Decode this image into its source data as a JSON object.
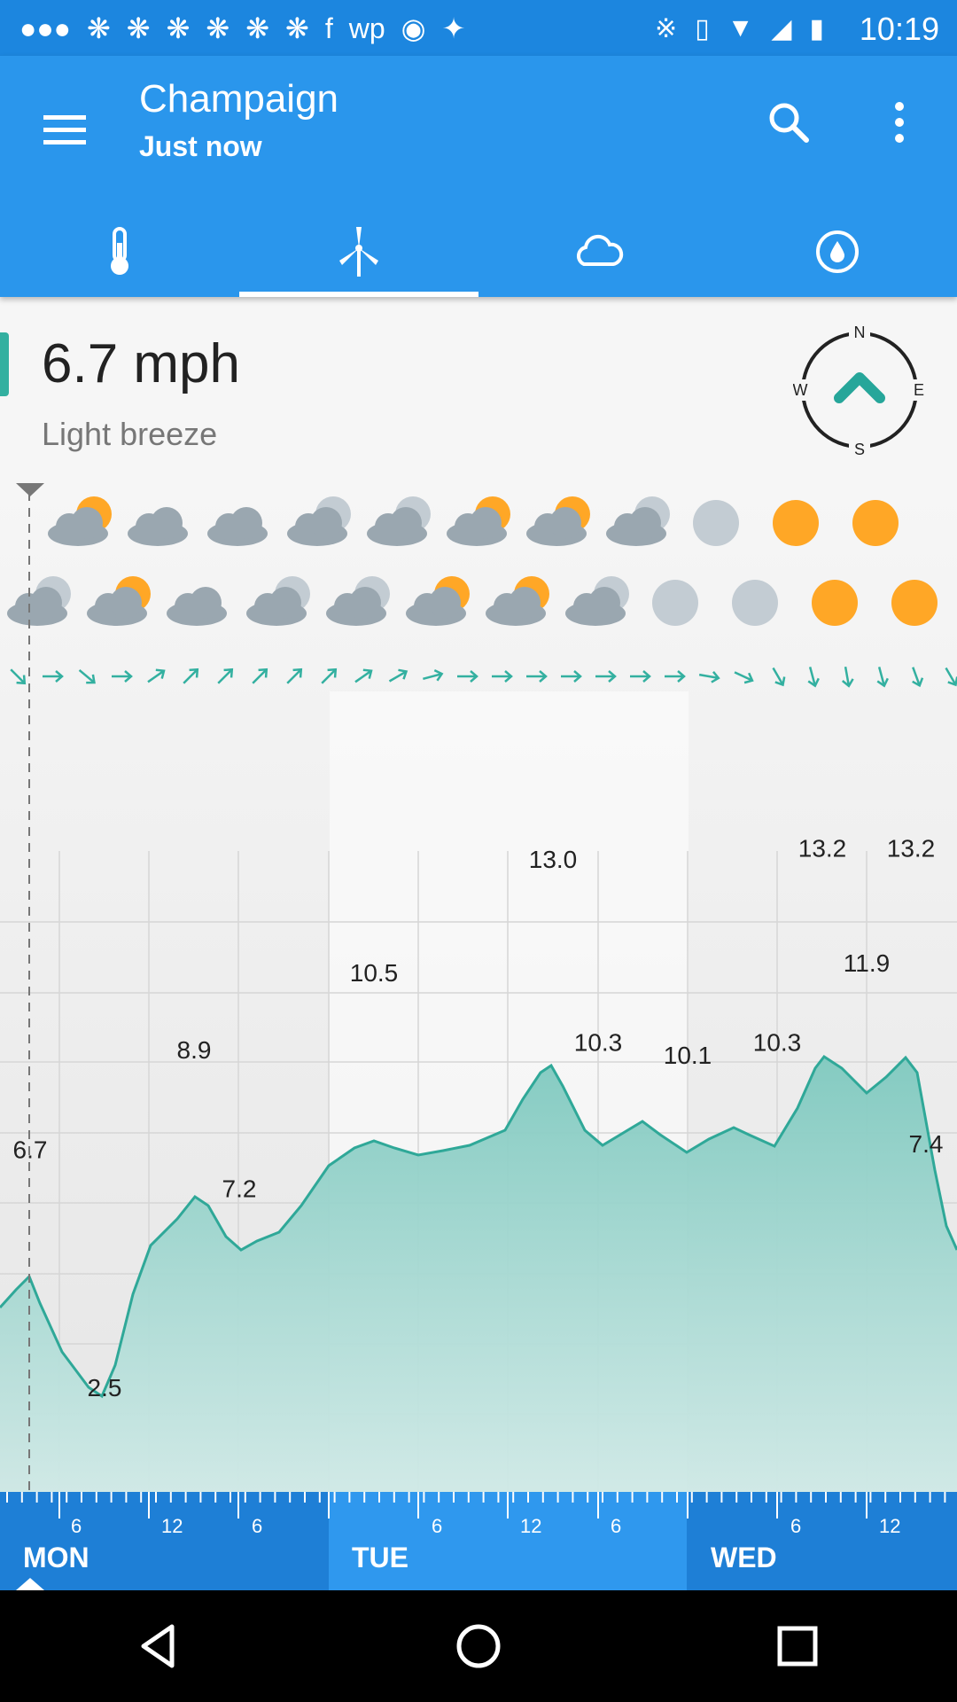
{
  "status_bar": {
    "time": "10:19",
    "left_icons": [
      "more-icon",
      "fan-icon",
      "fan-icon",
      "fan-icon",
      "fan-icon",
      "fan-icon",
      "fan-icon",
      "facebook-icon",
      "washington-post-icon",
      "lock-icon",
      "satellite-icon"
    ],
    "right_icons": [
      "bluetooth-icon",
      "vibrate-icon",
      "wifi-icon",
      "signal-icon",
      "battery-icon"
    ]
  },
  "header": {
    "title": "Champaign",
    "subtitle": "Just now",
    "menu_icon": "menu-icon",
    "search_icon": "search-icon",
    "more_icon": "more-vert-icon"
  },
  "tabs": [
    {
      "name": "temperature",
      "icon": "thermometer-icon",
      "active": false
    },
    {
      "name": "wind",
      "icon": "wind-turbine-icon",
      "active": true
    },
    {
      "name": "cloud",
      "icon": "cloud-icon",
      "active": false
    },
    {
      "name": "precipitation",
      "icon": "droplet-icon",
      "active": false
    }
  ],
  "current": {
    "speed": "6.7 mph",
    "description": "Light breeze",
    "compass": {
      "n": "N",
      "s": "S",
      "e": "E",
      "w": "W"
    }
  },
  "chart_data": {
    "type": "area",
    "series": [
      {
        "values": [
          6.7,
          2.5,
          8.9,
          7.2,
          10.5,
          13.0,
          10.3,
          10.1,
          10.3,
          13.2,
          11.9,
          13.2,
          7.4
        ]
      }
    ],
    "data_labels": [
      "6.7",
      "2.5",
      "8.9",
      "7.2",
      "10.5",
      "13.0",
      "10.3",
      "10.1",
      "10.3",
      "13.2",
      "11.9",
      "13.2",
      "7.4"
    ],
    "days": [
      "MON",
      "TUE",
      "WED"
    ],
    "hour_ticks": [
      "6",
      "12",
      "6",
      "6",
      "12",
      "6",
      "6",
      "12"
    ],
    "grid": true
  },
  "weather_icons": {
    "row1": [
      "partly-sunny",
      "cloudy",
      "cloudy",
      "cloudy-night",
      "cloudy-night",
      "partly-sunny",
      "partly-sunny",
      "cloudy-night",
      "moon",
      "sun",
      "sun"
    ],
    "row2": [
      "cloudy-night",
      "partly-sunny",
      "cloudy",
      "cloudy-night",
      "cloudy-night",
      "partly-sunny",
      "partly-sunny",
      "cloudy-night",
      "moon",
      "moon",
      "sun",
      "sun"
    ]
  },
  "colors": {
    "header": "#2a96ec",
    "status_bar": "#1c86df",
    "accent": "#33b0a0",
    "timeline": "#1e7fd6",
    "sun": "#ffa726",
    "cloud": "#9aa7b0"
  },
  "nav": [
    "back-icon",
    "home-icon",
    "recents-icon"
  ]
}
